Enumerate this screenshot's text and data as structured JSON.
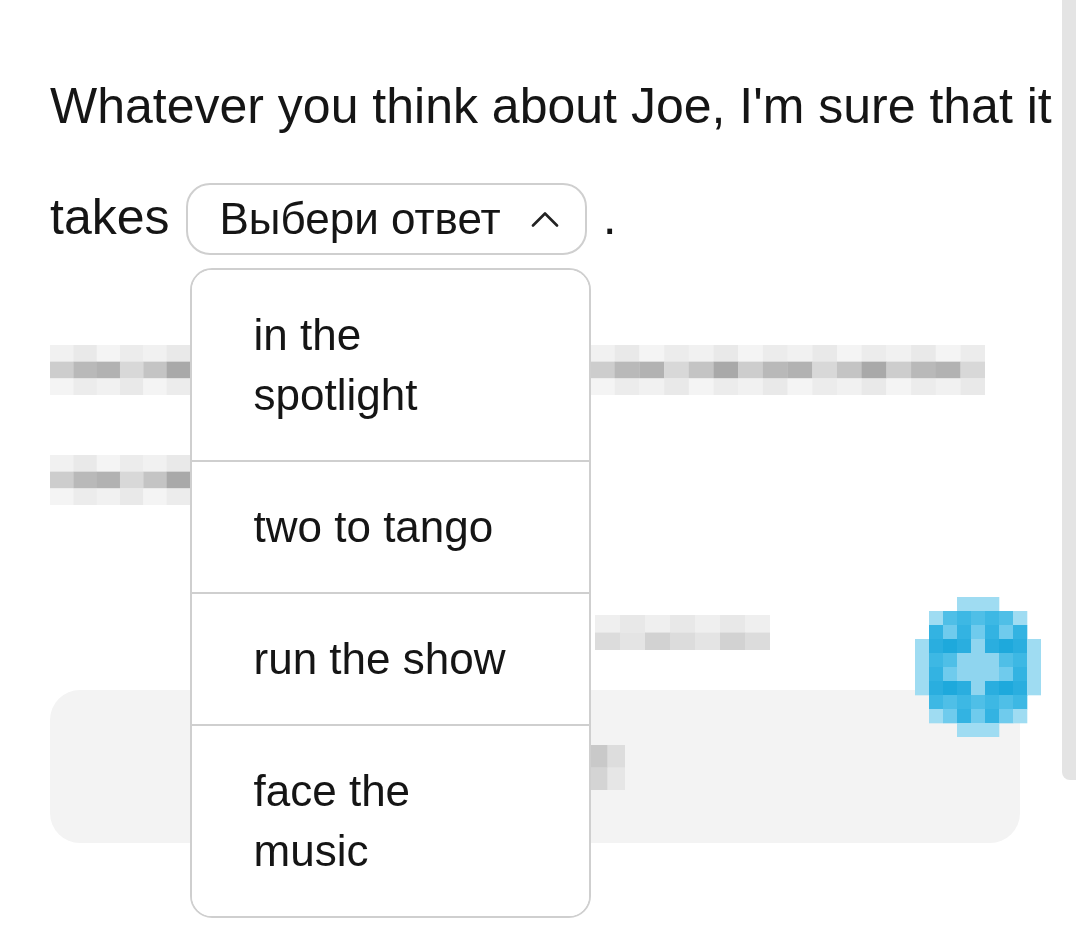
{
  "question": {
    "lines": [
      "Whatever you think about Joe, I'm sure that it",
      "takes"
    ],
    "ending": ".",
    "dropdown": {
      "placeholder": "Выбери ответ",
      "expanded": true,
      "options": [
        {
          "label": "in the spotlight",
          "selected": false
        },
        {
          "label": "two to tango",
          "selected": false
        },
        {
          "label": "run the show",
          "selected": false
        },
        {
          "label": "face the music",
          "selected": false
        }
      ]
    }
  }
}
